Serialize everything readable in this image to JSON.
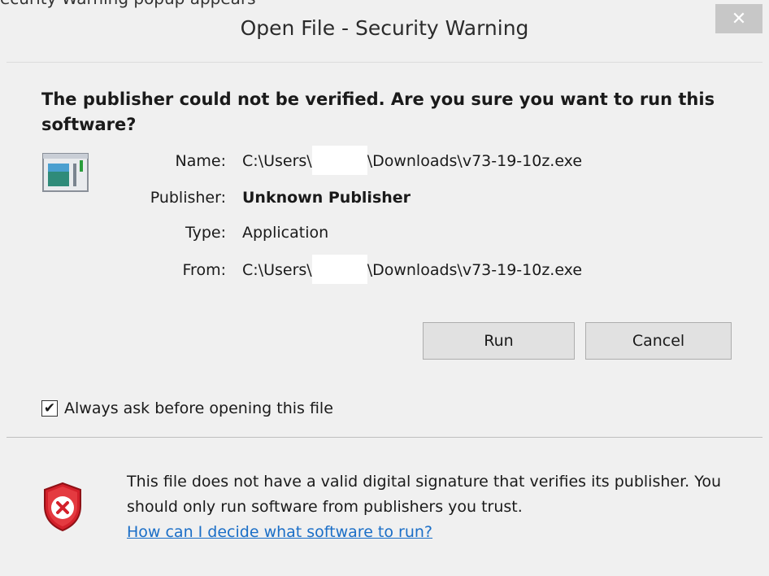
{
  "window": {
    "cropped_text": "ecurity Warning popup appears",
    "title": "Open File - Security Warning",
    "close_glyph": "✕"
  },
  "dialog": {
    "headline": "The publisher could not be verified.  Are you sure you want to run this software?",
    "icon": "application-icon",
    "fields": {
      "name_label": "Name:",
      "name_value_prefix": "C:\\Users\\",
      "name_value_suffix": "\\Downloads\\v73-19-10z.exe",
      "publisher_label": "Publisher:",
      "publisher_value": "Unknown Publisher",
      "type_label": "Type:",
      "type_value": "Application",
      "from_label": "From:",
      "from_value_prefix": "C:\\Users\\",
      "from_value_suffix": "\\Downloads\\v73-19-10z.exe"
    },
    "buttons": {
      "run": "Run",
      "cancel": "Cancel"
    },
    "checkbox": {
      "label": "Always ask before opening this file",
      "checked": true,
      "glyph": "✔"
    },
    "footer": {
      "icon": "shield-error-icon",
      "text": "This file does not have a valid digital signature that verifies its publisher.  You should only run software from publishers you trust.",
      "link": "How can I decide what software to run?"
    }
  },
  "colors": {
    "link": "#1a6ec7",
    "close_button": "#c7c7c7",
    "shield_red": "#d3202a"
  }
}
